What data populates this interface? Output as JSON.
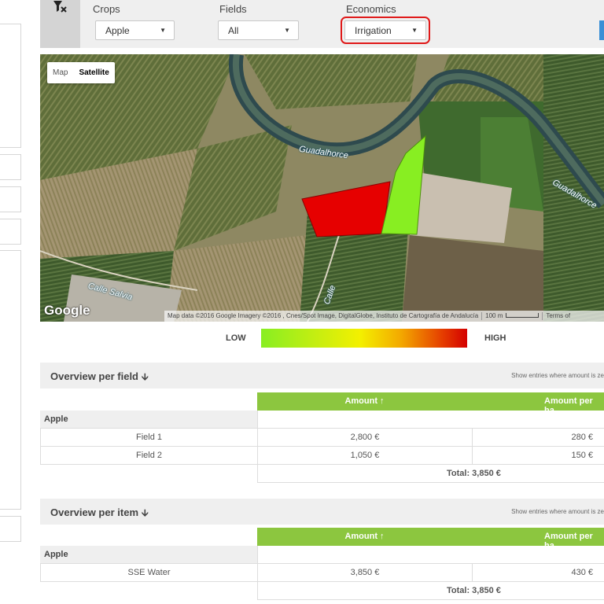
{
  "filters": {
    "crops": {
      "label": "Crops",
      "value": "Apple"
    },
    "fields": {
      "label": "Fields",
      "value": "All"
    },
    "economics": {
      "label": "Economics",
      "value": "Irrigation"
    }
  },
  "map": {
    "type_buttons": {
      "map": "Map",
      "satellite": "Satellite"
    },
    "labels": {
      "river_1": "Guadalhorce",
      "river_2": "Guadalhorce",
      "street_1": "Calle Salvia",
      "street_2": "Calle"
    },
    "logo": "Google",
    "attribution": "Map data ©2016 Google Imagery ©2016 , Cnes/Spot Image, DigitalGlobe, Instituto de Cartografía de Andalucía",
    "scale": "100 m",
    "terms": "Terms of",
    "field_colors": {
      "field_1": "#e60000",
      "field_2": "#88ee22"
    }
  },
  "legend": {
    "low": "LOW",
    "high": "HIGH"
  },
  "overview_field": {
    "title": "Overview per field",
    "note": "Show entries where amount is ze",
    "col_amount": "Amount ↑",
    "col_per_ha": "Amount per ha",
    "group": "Apple",
    "rows": [
      {
        "name": "Field 1",
        "amount": "2,800 €",
        "per_ha": "280 €"
      },
      {
        "name": "Field 2",
        "amount": "1,050 €",
        "per_ha": "150 €"
      }
    ],
    "total": "Total: 3,850 €"
  },
  "overview_item": {
    "title": "Overview per item",
    "note": "Show entries where amount is ze",
    "col_amount": "Amount ↑",
    "col_per_ha": "Amount per ha",
    "group": "Apple",
    "rows": [
      {
        "name": "SSE Water",
        "amount": "3,850 €",
        "per_ha": "430 €"
      }
    ],
    "total": "Total: 3,850  €"
  },
  "colors": {
    "accent_green": "#8cc63f",
    "highlight_red": "#e01919"
  }
}
